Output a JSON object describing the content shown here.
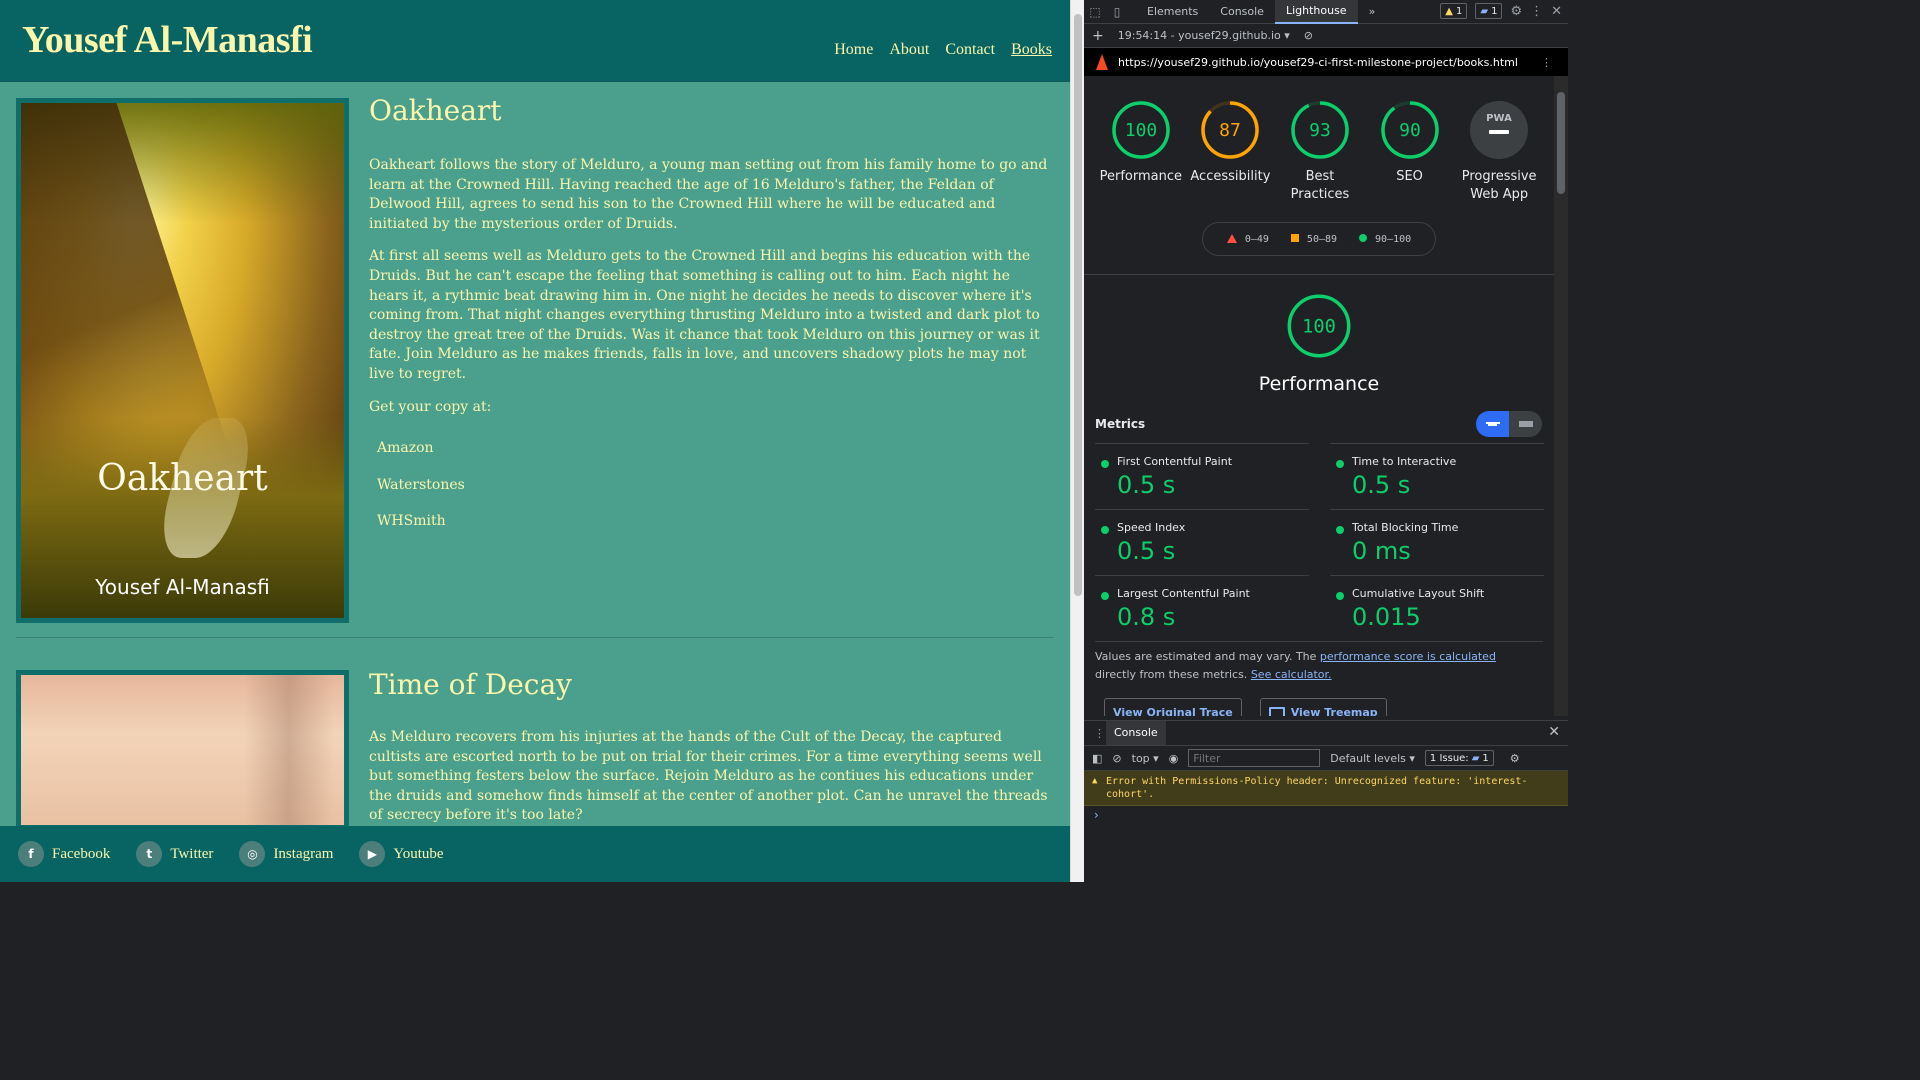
{
  "site": {
    "brand": "Yousef Al-Manasfi",
    "nav": [
      "Home",
      "About",
      "Contact",
      "Books"
    ],
    "active_nav": "Books",
    "books": [
      {
        "title": "Oakheart",
        "cover_title": "Oakheart",
        "cover_author": "Yousef Al-Manasfi",
        "paragraphs": [
          "Oakheart follows the story of Melduro, a young man setting out from his family home to go and learn at the Crowned Hill. Having reached the age of 16 Melduro's father, the Feldan of Delwood Hill, agrees to send his son to the Crowned Hill where he will be educated and initiated by the mysterious order of Druids.",
          "At first all seems well as Melduro gets to the Crowned Hill and begins his education with the Druids. But he can't escape the feeling that something is calling out to him. Each night he hears it, a rythmic beat drawing him in. One night he decides he needs to discover where it's coming from. That night changes everything thrusting Melduro into a twisted and dark plot to destroy the great tree of the Druids. Was it chance that took Melduro on this journey or was it fate. Join Melduro as he makes friends, falls in love, and uncovers shadowy plots he may not live to regret."
        ],
        "get_copy": "Get your copy at:",
        "stores": [
          "Amazon",
          "Waterstones",
          "WHSmith"
        ]
      },
      {
        "title": "Time of Decay",
        "paragraphs": [
          "As Melduro recovers from his injuries at the hands of the Cult of the Decay, the captured cultists are escorted north to be put on trial for their crimes. For a time everything seems well but something festers below the surface. Rejoin Melduro as he contiues his educations under the druids and somehow finds himself at the center of another plot. Can he unravel the threads of secrecy before it's too late?"
        ]
      }
    ],
    "footer": [
      {
        "icon": "facebook-icon",
        "glyph": "f",
        "label": "Facebook"
      },
      {
        "icon": "twitter-icon",
        "glyph": "t",
        "label": "Twitter"
      },
      {
        "icon": "instagram-icon",
        "glyph": "◎",
        "label": "Instagram"
      },
      {
        "icon": "youtube-icon",
        "glyph": "▶",
        "label": "Youtube"
      }
    ],
    "colors": {
      "header": "#076462",
      "body": "#4ba08d",
      "text": "#fbf6ab"
    }
  },
  "devtools": {
    "tabs": [
      "Elements",
      "Console",
      "Lighthouse"
    ],
    "active_tab": "Lighthouse",
    "more_tabs": "»",
    "warnings_count": "1",
    "messages_count": "1",
    "report_selector": "19:54:14 - yousef29.github.io",
    "url": "https://yousef29.github.io/yousef29-ci-first-milestone-project/books.html",
    "categories": [
      {
        "score": 100,
        "label": "Performance",
        "color": "#0cce6b"
      },
      {
        "score": 87,
        "label": "Accessibility",
        "color": "#ffa400"
      },
      {
        "score": 93,
        "label": "Best Practices",
        "color": "#0cce6b"
      },
      {
        "score": 90,
        "label": "SEO",
        "color": "#0cce6b"
      }
    ],
    "pwa_label": "Progressive Web App",
    "pwa_badge": "PWA",
    "legend": [
      "0–49",
      "50–89",
      "90–100"
    ],
    "performance_score": 100,
    "performance_title": "Performance",
    "metrics_title": "Metrics",
    "metrics": [
      {
        "name": "First Contentful Paint",
        "value": "0.5 s"
      },
      {
        "name": "Time to Interactive",
        "value": "0.5 s"
      },
      {
        "name": "Speed Index",
        "value": "0.5 s"
      },
      {
        "name": "Total Blocking Time",
        "value": "0 ms"
      },
      {
        "name": "Largest Contentful Paint",
        "value": "0.8 s"
      },
      {
        "name": "Cumulative Layout Shift",
        "value": "0.015"
      }
    ],
    "note_prefix": "Values are estimated and may vary. The ",
    "note_link1": "performance score is calculated",
    "note_middle": " directly from these metrics. ",
    "note_link2": "See calculator.",
    "view_trace": "View Original Trace",
    "view_treemap": "View Treemap",
    "drawer_tab": "Console",
    "context": "top",
    "filter_placeholder": "Filter",
    "levels": "Default levels",
    "issues": "1 Issue:",
    "issues_count": "1",
    "error": "Error with Permissions-Policy header: Unrecognized feature: 'interest-cohort'.",
    "prompt": "›"
  }
}
